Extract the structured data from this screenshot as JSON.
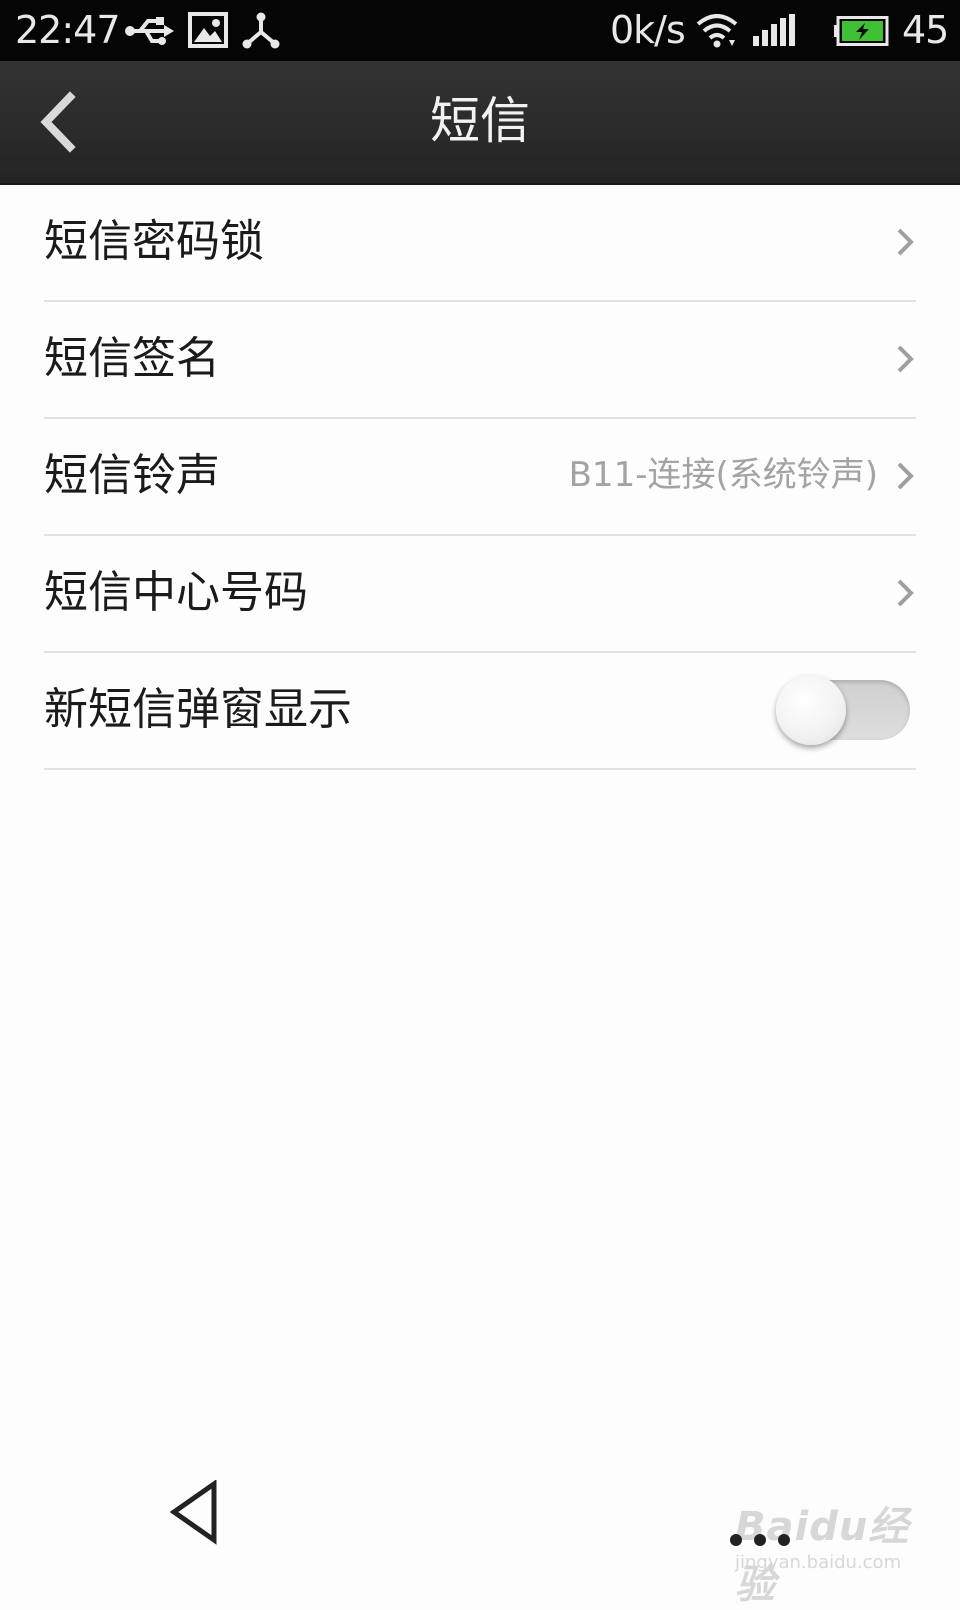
{
  "status_bar": {
    "time": "22:47",
    "speed": "0k/s",
    "battery_level": "45",
    "icons": [
      "usb-icon",
      "image-icon",
      "share-icon",
      "wifi-icon",
      "signal-icon",
      "battery-icon"
    ],
    "battery_color": "#3fbf33"
  },
  "title_bar": {
    "title": "短信"
  },
  "settings": {
    "items": [
      {
        "label": "短信密码锁",
        "value": ""
      },
      {
        "label": "短信签名",
        "value": ""
      },
      {
        "label": "短信铃声",
        "value": "B11-连接(系统铃声)"
      },
      {
        "label": "短信中心号码",
        "value": ""
      },
      {
        "label": "新短信弹窗显示",
        "toggle_on": false
      }
    ]
  },
  "watermark": {
    "logo": "Baidu经验",
    "url": "jingyan.baidu.com"
  }
}
